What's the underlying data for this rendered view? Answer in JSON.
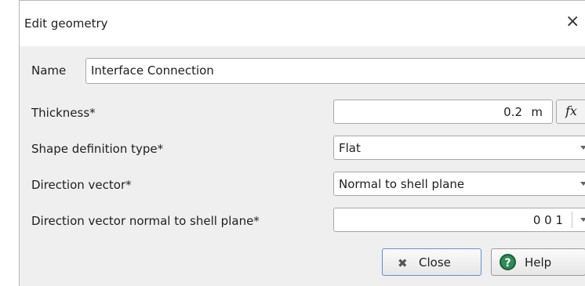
{
  "window": {
    "title": "Edit geometry",
    "close_glyph": "×"
  },
  "name_row": {
    "label": "Name",
    "value": "Interface Connection"
  },
  "thickness": {
    "label": "Thickness*",
    "value": "0.2",
    "unit": "m",
    "fx_label": "fx"
  },
  "shape_type": {
    "label": "Shape definition type*",
    "selected": "Flat"
  },
  "direction_vector": {
    "label": "Direction vector*",
    "selected": "Normal to shell plane"
  },
  "direction_normal": {
    "label": "Direction vector normal to shell plane*",
    "value": "0 0 1"
  },
  "buttons": {
    "close_label": "Close",
    "help_label": "Help",
    "close_icon_glyph": "✖",
    "help_icon_glyph": "?"
  },
  "colors": {
    "help_icon": "#2e8b57",
    "focus_border": "#5d8fd6",
    "dialog_bg": "#efefef"
  }
}
